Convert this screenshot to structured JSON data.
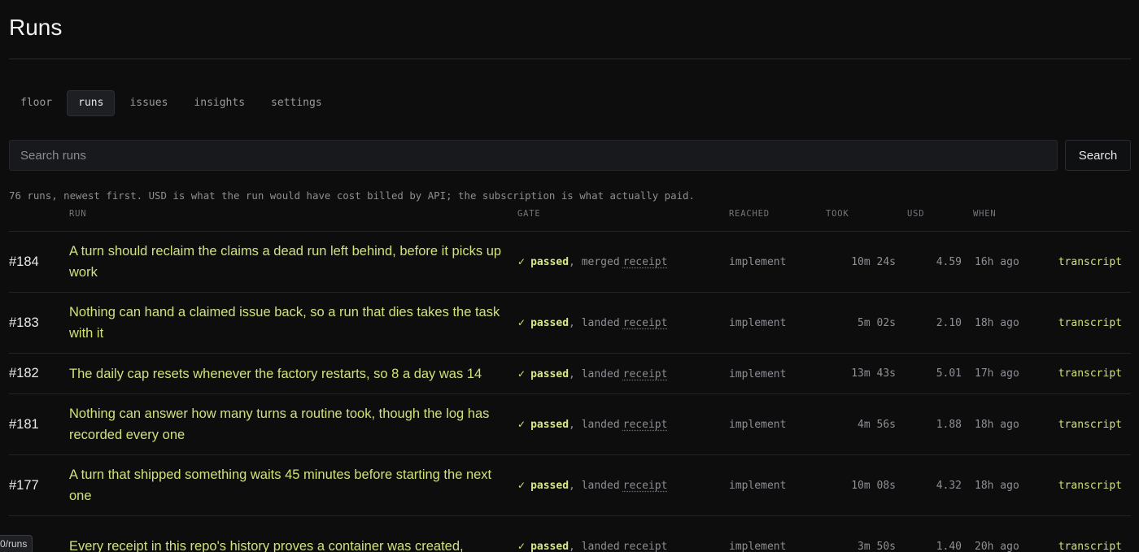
{
  "page": {
    "title": "Runs"
  },
  "tabs": [
    {
      "label": "floor",
      "active": false
    },
    {
      "label": "runs",
      "active": true
    },
    {
      "label": "issues",
      "active": false
    },
    {
      "label": "insights",
      "active": false
    },
    {
      "label": "settings",
      "active": false
    }
  ],
  "search": {
    "placeholder": "Search runs",
    "value": "",
    "button_label": "Search"
  },
  "summary": "76 runs, newest first. USD is what the run would have cost billed by API; the subscription is what actually paid.",
  "table": {
    "headers": {
      "run": "RUN",
      "gate": "GATE",
      "reached": "REACHED",
      "took": "TOOK",
      "usd": "USD",
      "when": "WHEN"
    },
    "rows": [
      {
        "number": "#184",
        "title": "A turn should reclaim the claims a dead run left behind, before it picks up work",
        "gate_status": "passed",
        "gate_result": "merged",
        "receipt_label": "receipt",
        "reached": "implement",
        "took": "10m 24s",
        "usd": "4.59",
        "when": "16h ago",
        "transcript_label": "transcript"
      },
      {
        "number": "#183",
        "title": "Nothing can hand a claimed issue back, so a run that dies takes the task with it",
        "gate_status": "passed",
        "gate_result": "landed",
        "receipt_label": "receipt",
        "reached": "implement",
        "took": "5m 02s",
        "usd": "2.10",
        "when": "18h ago",
        "transcript_label": "transcript"
      },
      {
        "number": "#182",
        "title": "The daily cap resets whenever the factory restarts, so 8 a day was 14",
        "gate_status": "passed",
        "gate_result": "landed",
        "receipt_label": "receipt",
        "reached": "implement",
        "took": "13m 43s",
        "usd": "5.01",
        "when": "17h ago",
        "transcript_label": "transcript"
      },
      {
        "number": "#181",
        "title": "Nothing can answer how many turns a routine took, though the log has recorded every one",
        "gate_status": "passed",
        "gate_result": "landed",
        "receipt_label": "receipt",
        "reached": "implement",
        "took": "4m 56s",
        "usd": "1.88",
        "when": "18h ago",
        "transcript_label": "transcript"
      },
      {
        "number": "#177",
        "title": "A turn that shipped something waits 45 minutes before starting the next one",
        "gate_status": "passed",
        "gate_result": "landed",
        "receipt_label": "receipt",
        "reached": "implement",
        "took": "10m 08s",
        "usd": "4.32",
        "when": "18h ago",
        "transcript_label": "transcript"
      },
      {
        "number": "",
        "title": "Every receipt in this repo's history proves a container was created,",
        "gate_status": "passed",
        "gate_result": "landed",
        "receipt_label": "receipt",
        "reached": "implement",
        "took": "3m 50s",
        "usd": "1.40",
        "when": "20h ago",
        "transcript_label": "transcript"
      }
    ]
  },
  "status_url": "0/runs",
  "colors": {
    "background": "#0d0d0e",
    "accent": "#cfe27a",
    "muted": "#8f8f95"
  }
}
